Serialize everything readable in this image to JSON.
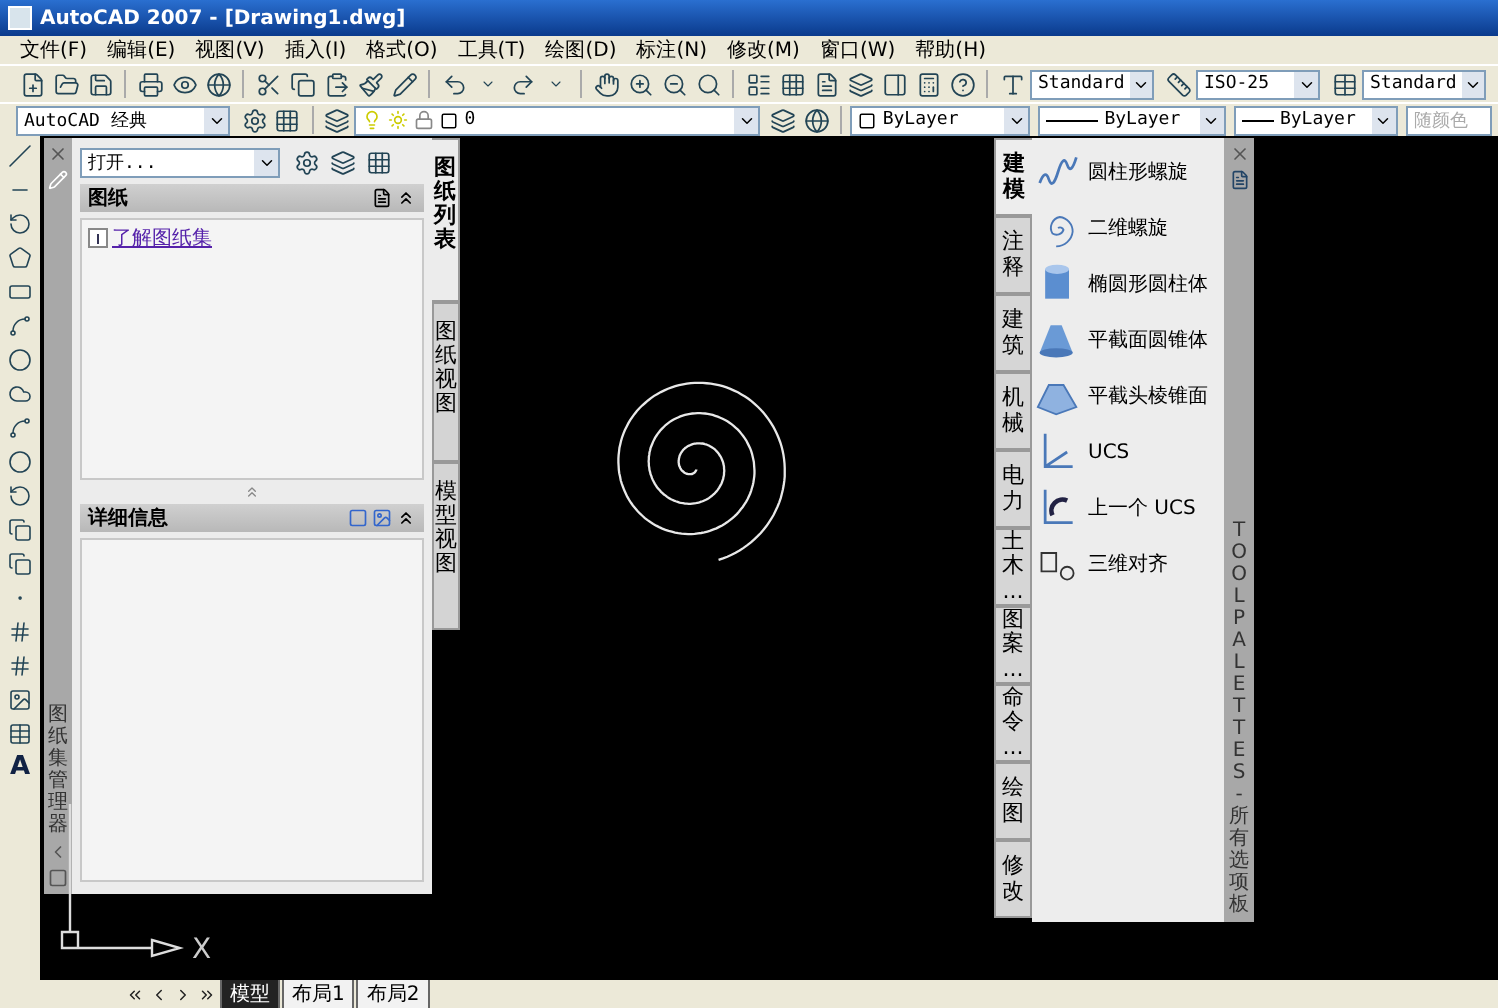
{
  "window": {
    "title": "AutoCAD 2007 - [Drawing1.dwg]"
  },
  "menu": [
    "文件(F)",
    "编辑(E)",
    "视图(V)",
    "插入(I)",
    "格式(O)",
    "工具(T)",
    "绘图(D)",
    "标注(N)",
    "修改(M)",
    "窗口(W)",
    "帮助(H)"
  ],
  "styles_toolbar": {
    "text_style": "Standard",
    "dim_style": "ISO-25",
    "table_style": "Standard"
  },
  "workspace": "AutoCAD 经典",
  "layer": "0",
  "properties": {
    "color_combo": "ByLayer",
    "linetype": "ByLayer",
    "lineweight": "ByLayer",
    "plot_style": {
      "value": "随颜色",
      "disabled": true
    }
  },
  "draw_toolbar": {
    "text_tool": "A"
  },
  "sheet_set_manager": {
    "title": "图纸集管理器",
    "open_combo": "打开...",
    "sheets_header": "图纸",
    "sheet_items": [
      "了解图纸集"
    ],
    "details_header": "详细信息",
    "tabs": [
      {
        "label": "图纸列表",
        "selected": true
      },
      {
        "label": "图纸视图",
        "selected": false
      },
      {
        "label": "模型视图",
        "selected": false
      }
    ]
  },
  "tool_palette": {
    "title": "TOOL PALETTES - 所有选项板",
    "tabs": [
      {
        "label": "建模",
        "selected": true
      },
      {
        "label": "注释",
        "selected": false
      },
      {
        "label": "建筑",
        "selected": false
      },
      {
        "label": "机械",
        "selected": false
      },
      {
        "label": "电力",
        "selected": false
      },
      {
        "label": "土木...",
        "selected": false
      },
      {
        "label": "图案...",
        "selected": false
      },
      {
        "label": "命令...",
        "selected": false
      },
      {
        "label": "绘图",
        "selected": false
      },
      {
        "label": "修改",
        "selected": false
      }
    ],
    "items": [
      {
        "label": "圆柱形螺旋",
        "kind": "helix"
      },
      {
        "label": "二维螺旋",
        "kind": "spiral"
      },
      {
        "label": "椭圆形圆柱体",
        "kind": "cylinder"
      },
      {
        "label": "平截面圆锥体",
        "kind": "cone"
      },
      {
        "label": "平截头棱锥面",
        "kind": "pyramid"
      },
      {
        "label": "UCS",
        "kind": "ucs"
      },
      {
        "label": "上一个 UCS",
        "kind": "ucs_previous"
      },
      {
        "label": "三维对齐",
        "kind": "align"
      }
    ]
  },
  "ucs_icon": {
    "axis_label": "X"
  },
  "layout_tabs": [
    {
      "label": "模型",
      "selected": true
    },
    {
      "label": "布局1",
      "selected": false
    },
    {
      "label": "布局2",
      "selected": false
    }
  ]
}
